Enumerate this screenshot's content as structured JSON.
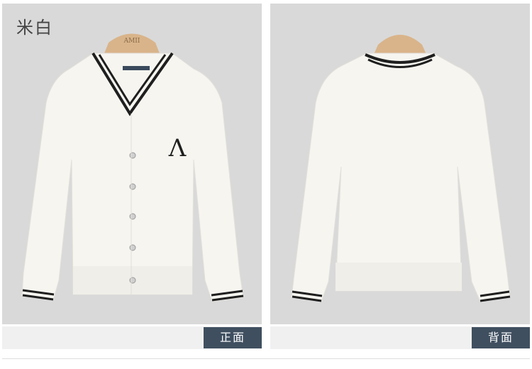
{
  "color_label": "米白",
  "hanger_brand": "AMII",
  "logo_mark": "Λ",
  "views": {
    "front_label": "正面",
    "back_label": "背面"
  },
  "colors": {
    "background": "#d9d9d9",
    "garment": "#f6f5f0",
    "trim": "#1f1f1f",
    "label_bg": "#3f4f60",
    "hanger": "#d9b48a"
  }
}
